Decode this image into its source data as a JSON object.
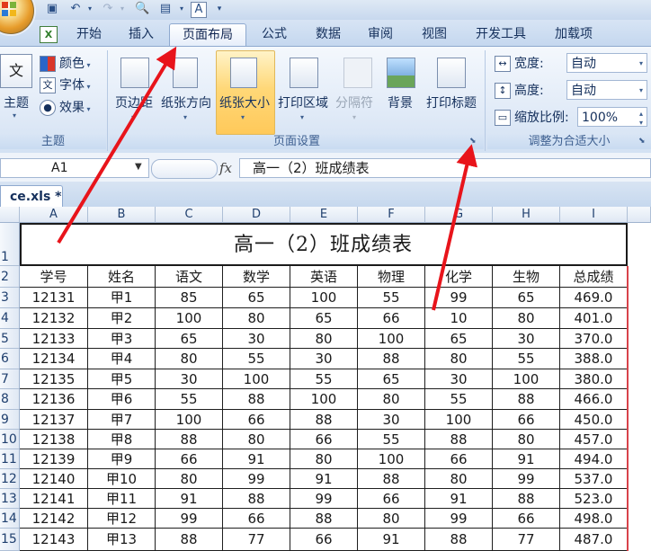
{
  "qat": {
    "icons": [
      "save-icon",
      "undo-icon",
      "redo-icon",
      "print-preview-icon",
      "quick-print-icon",
      "spelling-icon",
      "customize-icon"
    ]
  },
  "tabs": [
    "开始",
    "插入",
    "页面布局",
    "公式",
    "数据",
    "审阅",
    "视图",
    "开发工具",
    "加载项"
  ],
  "active_tab": "页面布局",
  "ribbon": {
    "theme_group": {
      "label": "主题",
      "theme_button": "主题",
      "colors": "颜色",
      "fonts": "字体",
      "effects": "效果"
    },
    "page_setup_group": {
      "label": "页面设置",
      "buttons": [
        "页边距",
        "纸张方向",
        "纸张大小",
        "打印区域",
        "分隔符",
        "背景",
        "打印标题"
      ],
      "highlighted": "纸张大小",
      "disabled": "分隔符"
    },
    "scale_group": {
      "label": "调整为合适大小",
      "width_label": "宽度:",
      "width_value": "自动",
      "height_label": "高度:",
      "height_value": "自动",
      "scale_label": "缩放比例:",
      "scale_value": "100%"
    }
  },
  "formula_bar": {
    "name_box": "A1",
    "fx": "fx",
    "content": "高一（2）班成绩表"
  },
  "workbook_tab": "ce.xls *",
  "sheet": {
    "columns": [
      "A",
      "B",
      "C",
      "D",
      "E",
      "F",
      "G",
      "H",
      "I"
    ],
    "row_numbers": [
      "1",
      "2",
      "3",
      "4",
      "5",
      "6",
      "7",
      "8",
      "9",
      "10",
      "11",
      "12",
      "13",
      "14",
      "15"
    ],
    "title": "高一（2）班成绩表",
    "headers": [
      "学号",
      "姓名",
      "语文",
      "数学",
      "英语",
      "物理",
      "化学",
      "生物",
      "总成绩"
    ],
    "rows": [
      [
        "12131",
        "甲1",
        "85",
        "65",
        "100",
        "55",
        "99",
        "65",
        "469.0"
      ],
      [
        "12132",
        "甲2",
        "100",
        "80",
        "65",
        "66",
        "10",
        "80",
        "401.0"
      ],
      [
        "12133",
        "甲3",
        "65",
        "30",
        "80",
        "100",
        "65",
        "30",
        "370.0"
      ],
      [
        "12134",
        "甲4",
        "80",
        "55",
        "30",
        "88",
        "80",
        "55",
        "388.0"
      ],
      [
        "12135",
        "甲5",
        "30",
        "100",
        "55",
        "65",
        "30",
        "100",
        "380.0"
      ],
      [
        "12136",
        "甲6",
        "55",
        "88",
        "100",
        "80",
        "55",
        "88",
        "466.0"
      ],
      [
        "12137",
        "甲7",
        "100",
        "66",
        "88",
        "30",
        "100",
        "66",
        "450.0"
      ],
      [
        "12138",
        "甲8",
        "88",
        "80",
        "66",
        "55",
        "88",
        "80",
        "457.0"
      ],
      [
        "12139",
        "甲9",
        "66",
        "91",
        "80",
        "100",
        "66",
        "91",
        "494.0"
      ],
      [
        "12140",
        "甲10",
        "80",
        "99",
        "91",
        "88",
        "80",
        "99",
        "537.0"
      ],
      [
        "12141",
        "甲11",
        "91",
        "88",
        "99",
        "66",
        "91",
        "88",
        "523.0"
      ],
      [
        "12142",
        "甲12",
        "99",
        "66",
        "88",
        "80",
        "99",
        "66",
        "498.0"
      ],
      [
        "12143",
        "甲13",
        "88",
        "77",
        "66",
        "91",
        "88",
        "77",
        "487.0"
      ]
    ]
  },
  "colors": {
    "ribbon_accent": "#ffd878",
    "annotation_red": "#e8141b"
  }
}
